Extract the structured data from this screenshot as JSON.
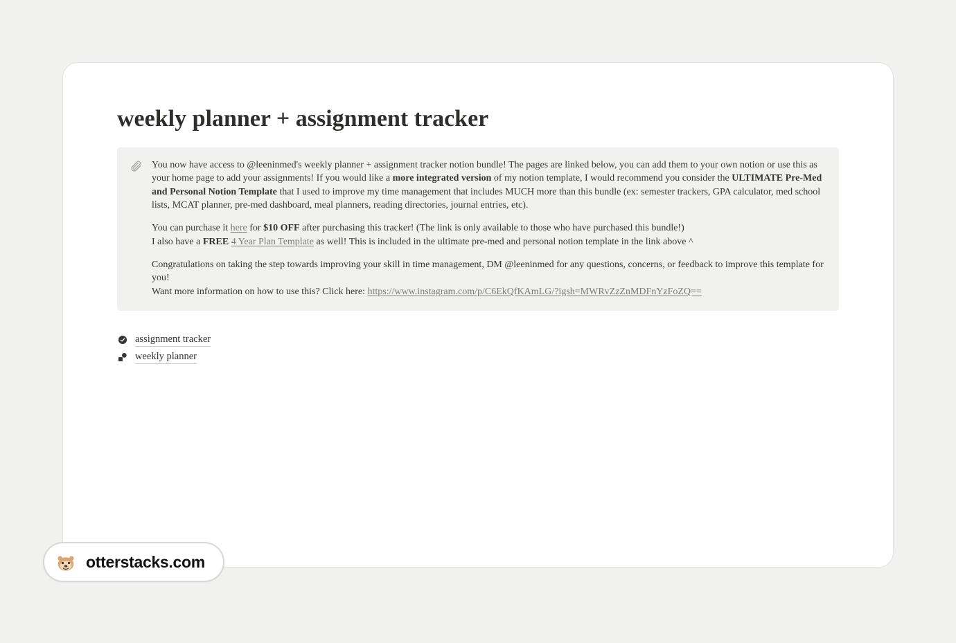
{
  "title": "weekly planner + assignment tracker",
  "callout": {
    "p1_a": "You now have access to @leeninmed's weekly planner + assignment tracker notion bundle! The pages are linked below, you can add them to your own notion or use this as your home page to add your assignments! If you would like a ",
    "p1_b_strong": "more integrated version",
    "p1_c": " of my notion template, I would recommend you consider the ",
    "p1_d_strong": "ULTIMATE Pre-Med and Personal Notion Template",
    "p1_e": " that I used to improve my time management that includes MUCH more than this bundle (ex: semester trackers, GPA calculator, med school lists, MCAT planner, pre-med dashboard, meal planners, reading directories, journal entries, etc).",
    "p2_a": "You can purchase it ",
    "p2_link1": "here",
    "p2_b": " for ",
    "p2_c_strong": "$10 OFF",
    "p2_d": " after purchasing this tracker! (The link is only available to those who have purchased this bundle!)",
    "p3_a": "I also have a ",
    "p3_b_strong": "FREE",
    "p3_c": " ",
    "p3_link2": "4 Year Plan Template",
    "p3_d": "  as well! This is included in the ultimate pre-med and personal notion template in the link above ^",
    "p4": "Congratulations on taking the step towards improving your skill in time management, DM @leeninmed for any questions, concerns, or feedback to improve this template for you!",
    "p5_a": "Want more information on how to use this? Click here: ",
    "p5_link3": "https://www.instagram.com/p/C6EkQfKAmLG/?igsh=MWRvZzZnMDFnYzFoZQ=="
  },
  "pageLinks": {
    "assignment": "assignment tracker",
    "weekly": "weekly planner"
  },
  "watermark": "otterstacks.com"
}
